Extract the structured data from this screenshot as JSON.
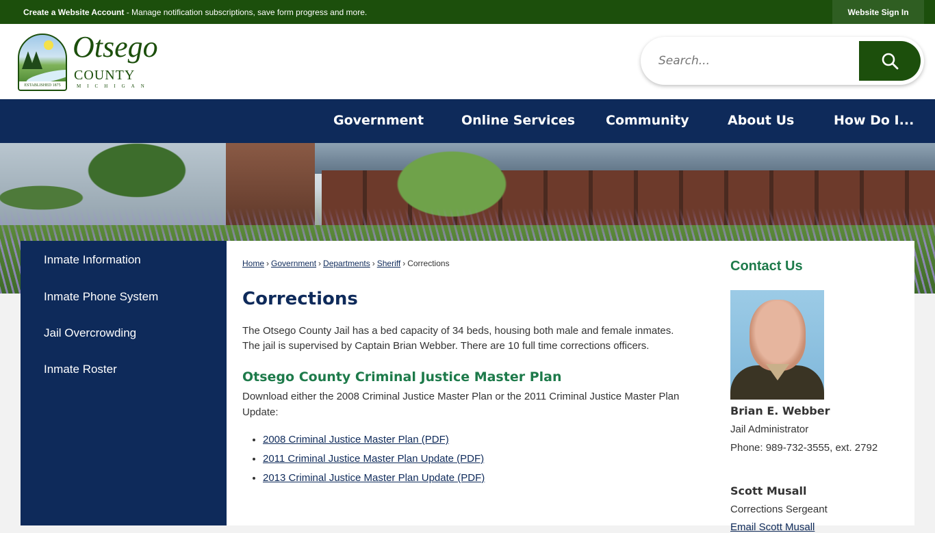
{
  "topbar": {
    "account_bold": "Create a Website Account",
    "account_rest": " - Manage notification subscriptions, save form progress and more.",
    "signin": "Website Sign In"
  },
  "logo": {
    "word1": "Otsego",
    "word2": "COUNTY",
    "word3": "MICHIGAN",
    "established": "ESTABLISHED 1875"
  },
  "search": {
    "placeholder": "Search...",
    "icon": "search-icon"
  },
  "nav": {
    "items": [
      "Government",
      "Online Services",
      "Community",
      "About Us",
      "How Do I..."
    ]
  },
  "sidebar": {
    "items": [
      "Inmate Information",
      "Inmate Phone System",
      "Jail Overcrowding",
      "Inmate Roster"
    ]
  },
  "breadcrumb": {
    "items": [
      "Home",
      "Government",
      "Departments",
      "Sheriff"
    ],
    "current": "Corrections",
    "separator": "›"
  },
  "main": {
    "title": "Corrections",
    "intro": "The Otsego County Jail has a bed capacity of 34 beds, housing both male and female inmates. The jail is supervised by Captain Brian Webber. There are 10 full time corrections officers.",
    "plan_heading": "Otsego County Criminal Justice Master Plan",
    "plan_text": "Download either the 2008 Criminal Justice Master Plan or the 2011 Criminal Justice Master Plan Update:",
    "documents": [
      "2008 Criminal Justice Master Plan (PDF)",
      "2011 Criminal Justice Master Plan Update (PDF)",
      "2013 Criminal Justice Master Plan Update (PDF)"
    ]
  },
  "contact": {
    "title": "Contact Us",
    "people": [
      {
        "name": "Brian E. Webber",
        "role": "Jail Administrator",
        "phone": "Phone: 989-732-3555, ext. 2792"
      },
      {
        "name": "Scott Musall",
        "role": "Corrections Sergeant",
        "email": "Email Scott Musall"
      }
    ]
  },
  "colors": {
    "topbar": "#1c4f0c",
    "navy": "#0e2a5a",
    "green_heading": "#1d7a4a"
  }
}
